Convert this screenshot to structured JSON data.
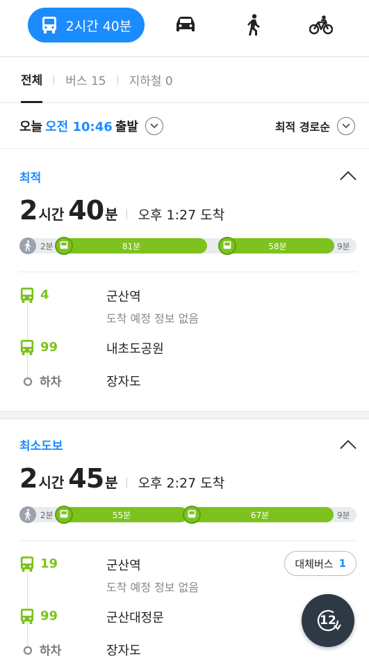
{
  "modes": {
    "transit_label": "2시간 40분",
    "transit_icon": "bus-icon",
    "car_icon": "car-icon",
    "walk_icon": "walk-icon",
    "bike_icon": "bike-icon"
  },
  "tabs": [
    {
      "label": "전체"
    },
    {
      "label": "버스 15"
    },
    {
      "label": "지하철 0"
    }
  ],
  "departure": {
    "prefix": "오늘",
    "time": "오전 10:46",
    "suffix": "출발",
    "sort_label": "최적 경로순"
  },
  "routes": [
    {
      "title": "최적",
      "hours": "2",
      "hours_unit": "시간",
      "minutes": "40",
      "minutes_unit": "분",
      "arrival": "오후 1:27 도착",
      "walk_start": "2분",
      "seg1": "81분",
      "seg2": "58분",
      "walk_end": "9분",
      "steps": [
        {
          "route": "4",
          "stop": "군산역",
          "sub": "도착 예정 정보 없음"
        },
        {
          "route": "99",
          "stop": "내초도공원"
        },
        {
          "off": "하차",
          "stop": "장자도"
        }
      ]
    },
    {
      "title": "최소도보",
      "hours": "2",
      "hours_unit": "시간",
      "minutes": "45",
      "minutes_unit": "분",
      "arrival": "오후 2:27 도착",
      "walk_start": "2분",
      "seg1": "55분",
      "seg2": "67분",
      "walk_end": "9분",
      "alt_bus_label": "대체버스",
      "alt_bus_count": "1",
      "steps": [
        {
          "route": "19",
          "stop": "군산역",
          "sub": "도착 예정 정보 없음"
        },
        {
          "route": "99",
          "stop": "군산대정문"
        },
        {
          "off": "하차",
          "stop": "장자도"
        }
      ]
    }
  ],
  "fab": {
    "label": "12",
    "icon": "refresh-icon"
  },
  "colors": {
    "accent": "#1a8cff",
    "bus": "#7dc21e",
    "fab": "#2d3a45"
  }
}
